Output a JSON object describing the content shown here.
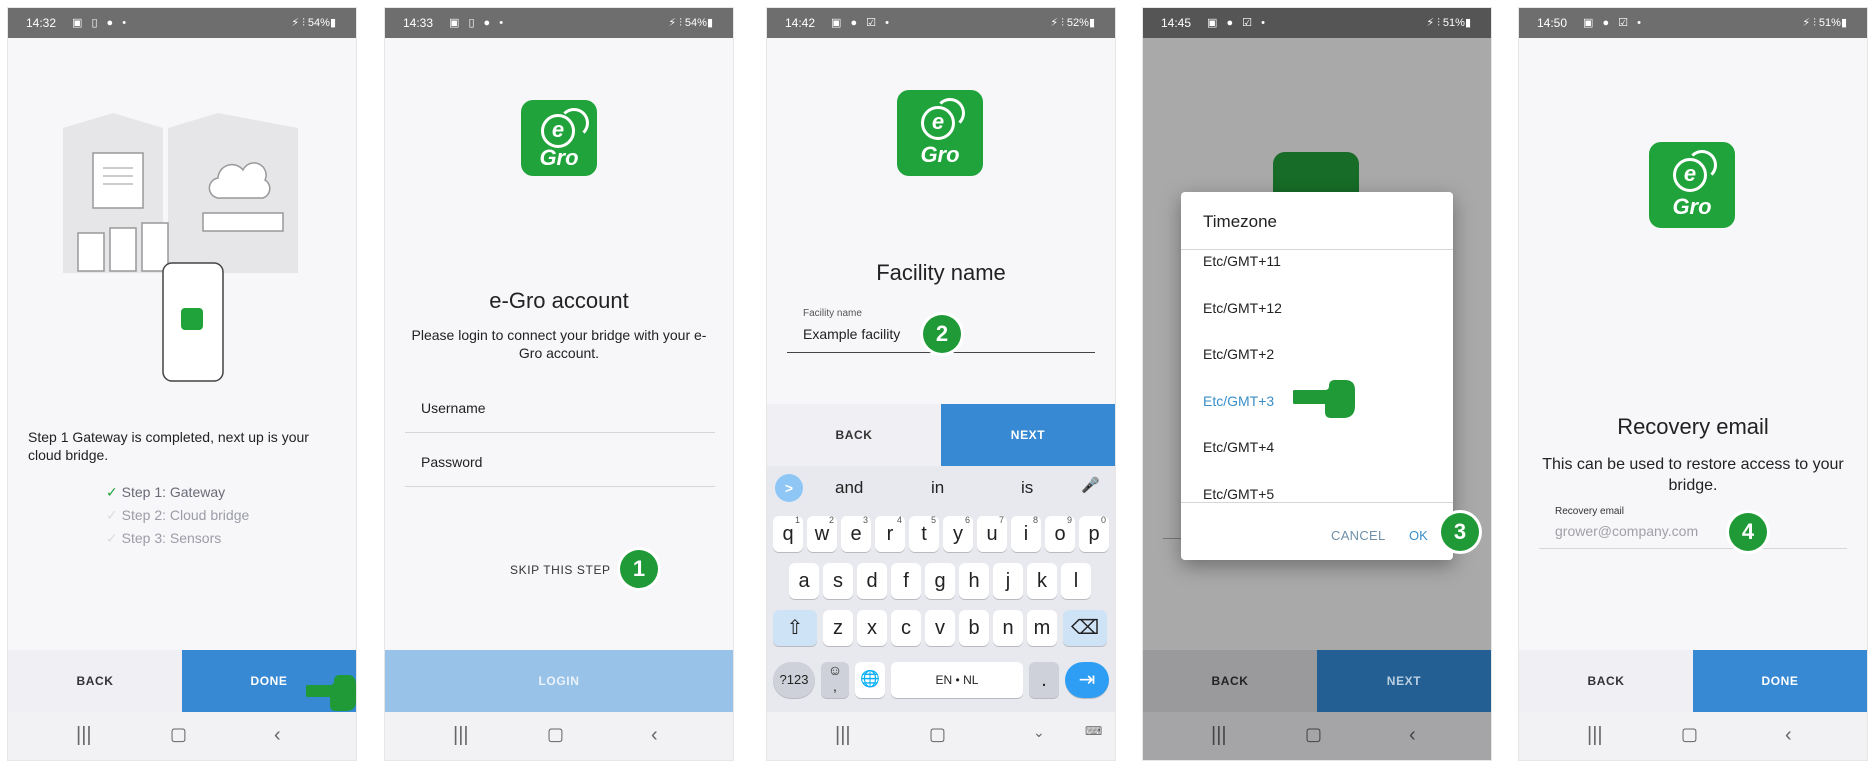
{
  "screen1": {
    "status": {
      "time": "14:32",
      "icons": "▣ ▯ ● •",
      "right": "⚡ ⫶ 54%▮"
    },
    "message": "Step 1 Gateway is completed, next up is your cloud bridge.",
    "steps": [
      {
        "check": "✓",
        "label": "Step 1: Gateway"
      },
      {
        "check": "✓",
        "label": "Step 2: Cloud bridge"
      },
      {
        "check": "✓",
        "label": "Step 3: Sensors"
      }
    ],
    "back": "BACK",
    "primary": "DONE",
    "logo": "Gro"
  },
  "screen2": {
    "status": {
      "time": "14:33",
      "icons": "▣ ▯ ● •",
      "right": "⚡ ⫶ 54%▮"
    },
    "logo": "Gro",
    "title": "e-Gro account",
    "description": "Please login to connect your bridge with your e-Gro account.",
    "username_placeholder": "Username",
    "password_placeholder": "Password",
    "skip": "SKIP THIS STEP",
    "badge": "1",
    "primary": "LOGIN"
  },
  "screen3": {
    "status": {
      "time": "14:42",
      "icons": "▣ ● ☑ •",
      "right": "⚡ ⫶ 52%▮"
    },
    "logo": "Gro",
    "title": "Facility name",
    "field_label": "Facility name",
    "field_value": "Example facility",
    "badge": "2",
    "back": "BACK",
    "primary": "NEXT",
    "suggestions": [
      ">",
      "and",
      "in",
      "is",
      "🎤"
    ],
    "row1": [
      [
        "q",
        "1"
      ],
      [
        "w",
        "2"
      ],
      [
        "e",
        "3"
      ],
      [
        "r",
        "4"
      ],
      [
        "t",
        "5"
      ],
      [
        "y",
        "6"
      ],
      [
        "u",
        "7"
      ],
      [
        "i",
        "8"
      ],
      [
        "o",
        "9"
      ],
      [
        "p",
        "0"
      ]
    ],
    "row2": [
      "a",
      "s",
      "d",
      "f",
      "g",
      "h",
      "j",
      "k",
      "l"
    ],
    "row3": [
      "⇧",
      "z",
      "x",
      "c",
      "v",
      "b",
      "n",
      "m",
      "⌫"
    ],
    "row4": {
      "sym": "?123",
      "emoji": "☺",
      "comma": ",",
      "globe": "🌐",
      "space": "EN • NL",
      "dot": ".",
      "enter": "⇥"
    }
  },
  "screen4": {
    "status": {
      "time": "14:45",
      "icons": "▣ ● ☑ •",
      "right": "⚡ ⫶ 51%▮"
    },
    "dialog_title": "Timezone",
    "options": [
      "Etc/GMT+11",
      "Etc/GMT+12",
      "Etc/GMT+2",
      "Etc/GMT+3",
      "Etc/GMT+4",
      "Etc/GMT+5"
    ],
    "selected_index": 3,
    "cancel": "CANCEL",
    "ok": "OK",
    "badge": "3",
    "back": "BACK",
    "primary": "NEXT"
  },
  "screen5": {
    "status": {
      "time": "14:50",
      "icons": "▣ ● ☑ •",
      "right": "⚡ ⫶ 51%▮"
    },
    "logo": "Gro",
    "title": "Recovery email",
    "description": "This can be used to restore access to your bridge.",
    "field_label": "Recovery email",
    "field_placeholder": "grower@company.com",
    "badge": "4",
    "back": "BACK",
    "primary": "DONE"
  },
  "nav": {
    "recents": "|||",
    "home": "▢",
    "back": "‹"
  },
  "colors": {
    "brand_green": "#1fa33a",
    "primary_blue": "#3789d4",
    "badge_green": "#1f9a36",
    "disabled_blue": "#99c2e8",
    "selected_text": "#3a8fc8"
  }
}
